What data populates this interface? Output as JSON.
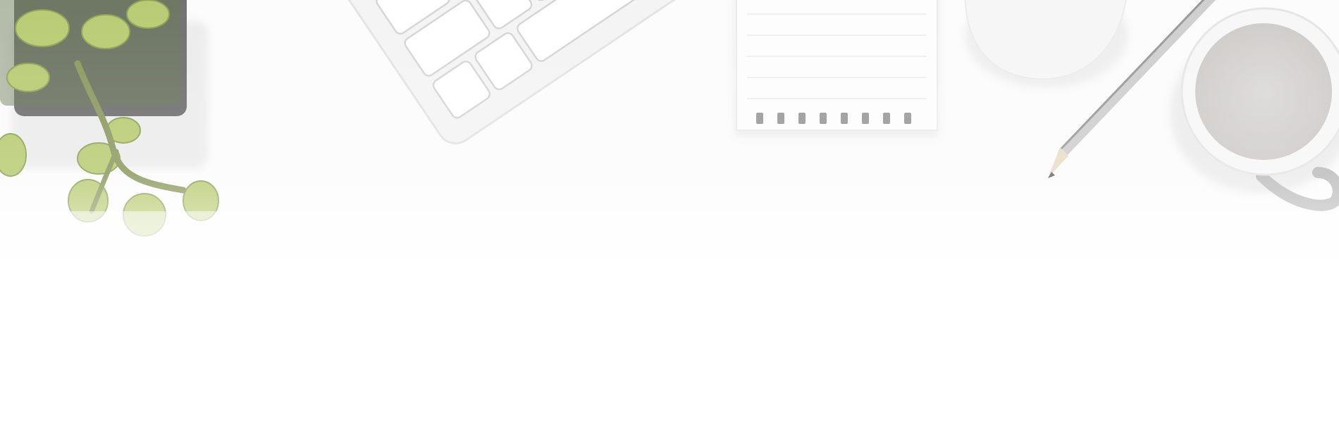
{
  "scene": {
    "description_type": "flat-lay desk photo banner",
    "colors": {
      "background": "#ffffff",
      "desk": "#fbfbfb",
      "key_fill": "#ffffff",
      "key_stroke": "#d9d9d9",
      "keyboard_body": "#f4f4f4",
      "plant_green": "#b9cc74",
      "plant_dark": "#5d6b4a",
      "pot": "#4a4a4a",
      "notepad": "#fdfdfd",
      "spiral": "#9a9a9a",
      "mouse": "#f6f6f6",
      "pencil_body": "#cfcfcf",
      "pencil_stripe": "#8a8a8a",
      "pencil_tip": "#6b6b6b",
      "cup": "#f7f7f7",
      "coffee": "#d6d4d2",
      "handle": "#bdbdbd"
    },
    "objects": [
      {
        "name": "succulent-plant"
      },
      {
        "name": "keyboard"
      },
      {
        "name": "spiral-notepad"
      },
      {
        "name": "mouse"
      },
      {
        "name": "pencil"
      },
      {
        "name": "coffee-cup"
      }
    ]
  }
}
